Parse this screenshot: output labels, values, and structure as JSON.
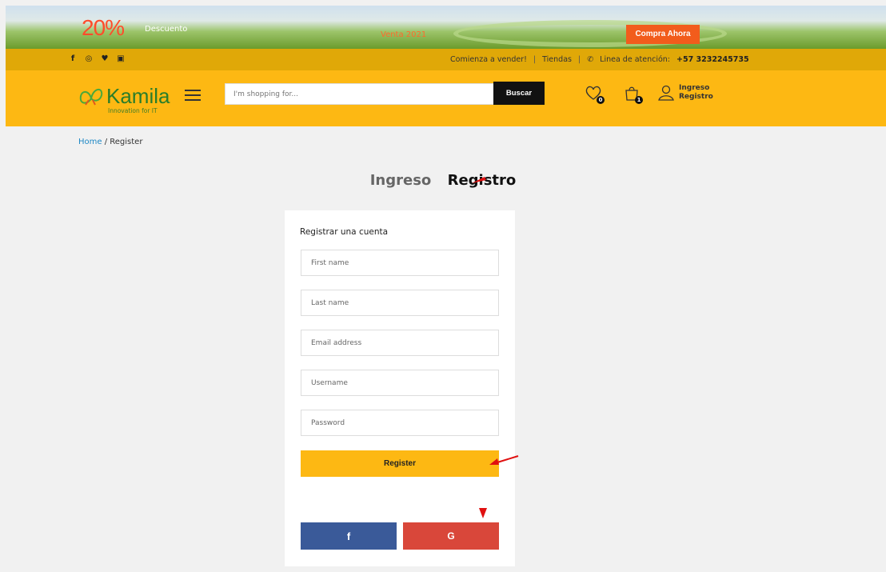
{
  "promo": {
    "percent": "20%",
    "discount_label": "Descuento",
    "subtitle": "Venta 2021",
    "cta_label": "Compra Ahora"
  },
  "topbar": {
    "social_icons": [
      "facebook-icon",
      "instagram-icon",
      "twitter-icon",
      "youtube-icon"
    ],
    "sell_link": "Comienza a vender!",
    "stores_link": "Tiendas",
    "phone_label": "Linea de atención:",
    "phone_number": "+57 3232245735"
  },
  "header": {
    "logo_text": "Kamila",
    "logo_tagline": "Innovation for IT",
    "search_placeholder": "I'm shopping for...",
    "search_button": "Buscar",
    "wishlist_count": "0",
    "cart_count": "1",
    "login_label": "Ingreso",
    "register_label": "Registro"
  },
  "breadcrumb": {
    "home": "Home",
    "separator": " / ",
    "current": "Register"
  },
  "tabs": {
    "login": "Ingreso",
    "register": "Registro"
  },
  "form": {
    "title": "Registrar una cuenta",
    "first_name_placeholder": "First name",
    "last_name_placeholder": "Last name",
    "email_placeholder": "Email address",
    "username_placeholder": "Username",
    "password_placeholder": "Password",
    "submit_label": "Register",
    "facebook_label": "f",
    "google_label": "G"
  },
  "colors": {
    "header_yellow": "#fdb813",
    "topbar_gold": "#e0a808",
    "facebook_blue": "#3a5a99",
    "google_red": "#d9473a",
    "annotation_red": "#e01010"
  }
}
